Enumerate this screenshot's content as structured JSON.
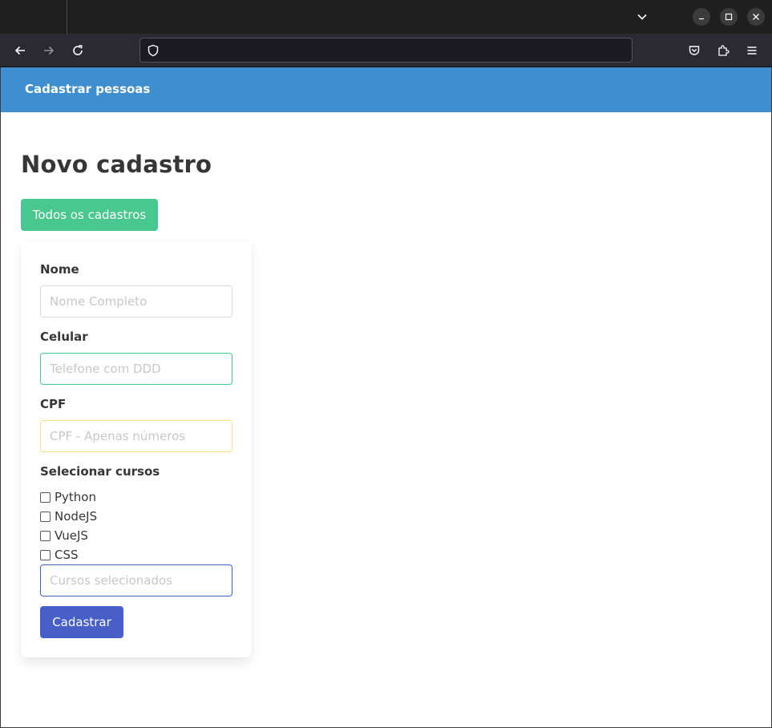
{
  "browser": {
    "url": "",
    "icons": {
      "tab_list": "chevron-down-icon",
      "minimize": "minimize-icon",
      "maximize": "maximize-icon",
      "close": "close-icon",
      "back": "back-arrow-icon",
      "forward": "forward-arrow-icon",
      "reload": "reload-icon",
      "site_security": "shield-icon",
      "pocket": "pocket-icon",
      "extensions": "extensions-icon",
      "menu": "hamburger-menu-icon"
    }
  },
  "header": {
    "brand": "Cadastrar pessoas",
    "color": "#3e8ed0"
  },
  "main": {
    "title": "Novo cadastro",
    "all_records_button": "Todos os cadastros",
    "all_records_color": "#48c78e"
  },
  "form": {
    "nome": {
      "label": "Nome",
      "placeholder": "Nome Completo",
      "value": ""
    },
    "celular": {
      "label": "Celular",
      "placeholder": "Telefone com DDD",
      "value": "",
      "border_color": "#48c78e"
    },
    "cpf": {
      "label": "CPF",
      "placeholder": "CPF - Apenas números",
      "value": "",
      "border_color": "#ffe08a"
    },
    "cursos": {
      "label": "Selecionar cursos",
      "options": [
        {
          "label": "Python",
          "checked": false
        },
        {
          "label": "NodeJS",
          "checked": false
        },
        {
          "label": "VueJS",
          "checked": false
        },
        {
          "label": "CSS",
          "checked": false
        }
      ],
      "selected_placeholder": "Cursos selecionados",
      "selected_value": "",
      "border_color": "#485fc7"
    },
    "submit": {
      "label": "Cadastrar",
      "color": "#485fc7"
    }
  }
}
